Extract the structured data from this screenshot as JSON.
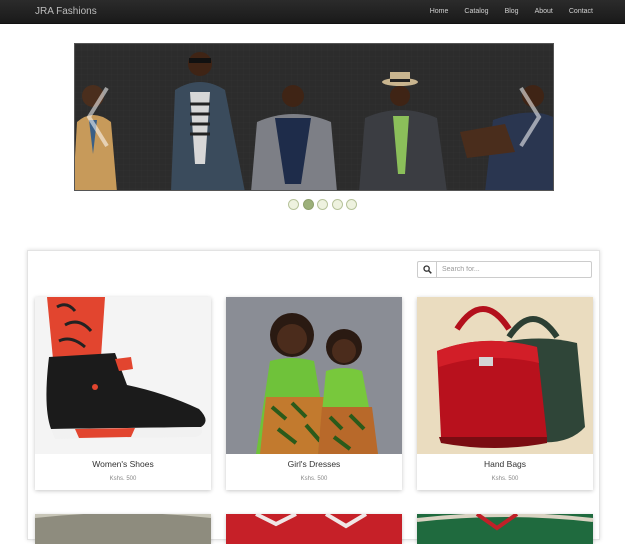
{
  "navbar": {
    "brand": "JRA Fashions",
    "links": [
      "Home",
      "Catalog",
      "Blog",
      "About",
      "Contact"
    ]
  },
  "carousel": {
    "slide_count": 5,
    "active_index": 1,
    "prev_icon": "chevron-left-icon",
    "next_icon": "chevron-right-icon"
  },
  "search": {
    "icon": "search-icon",
    "placeholder": "Search for...",
    "value": ""
  },
  "products": [
    {
      "title": "Women's Shoes",
      "price": "Kshs. 500"
    },
    {
      "title": "Girl's Dresses",
      "price": "Kshs. 500"
    },
    {
      "title": "Hand Bags",
      "price": "Kshs. 500"
    }
  ],
  "colors": {
    "navbar": "#222222",
    "dot_active": "#9cb07a",
    "dot_inactive": "#eef2df"
  }
}
